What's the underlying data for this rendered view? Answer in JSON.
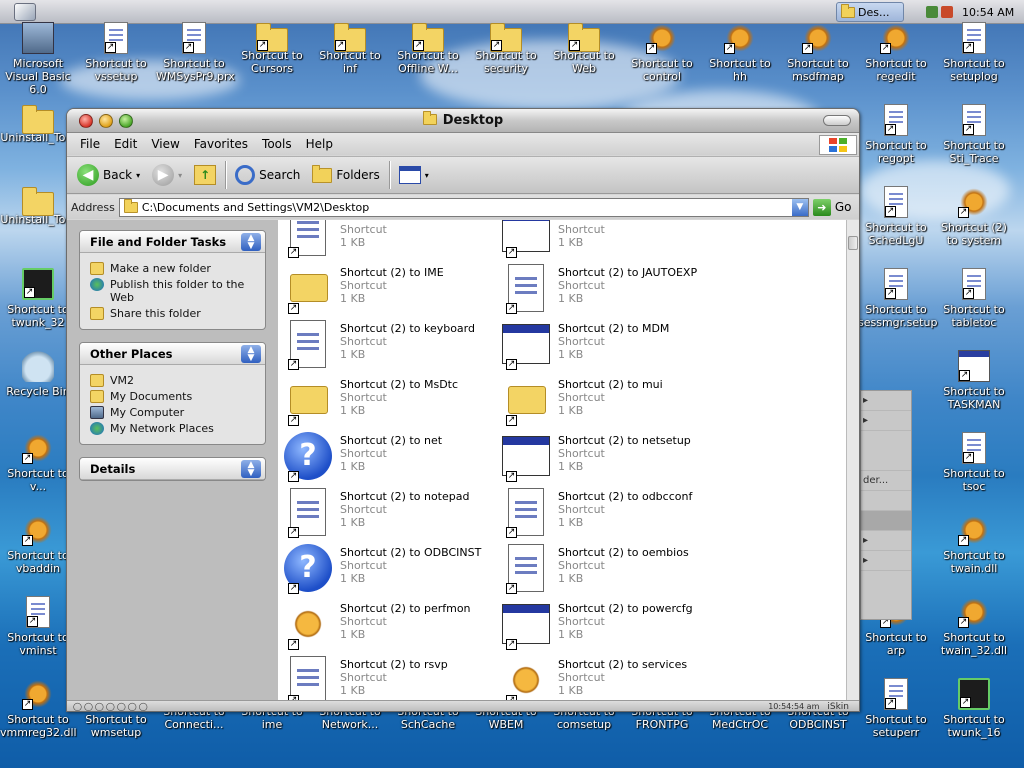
{
  "taskbar": {
    "task_label": "Des...",
    "clock": "10:54 AM"
  },
  "desktop_icons": [
    {
      "label": "Microsoft Visual Basic 6.0",
      "icon": "computer-icon"
    },
    {
      "label": "Shortcut to vssetup",
      "icon": "doc-icon"
    },
    {
      "label": "Shortcut to WMSysPr9.prx",
      "icon": "doc-icon"
    },
    {
      "label": "Shortcut to Cursors",
      "icon": "folder-icon"
    },
    {
      "label": "Shortcut to inf",
      "icon": "folder-icon"
    },
    {
      "label": "Shortcut to Offline W...",
      "icon": "folder-icon"
    },
    {
      "label": "Shortcut to security",
      "icon": "folder-icon"
    },
    {
      "label": "Shortcut to Web",
      "icon": "folder-icon"
    },
    {
      "label": "Shortcut to control",
      "icon": "gear-icon"
    },
    {
      "label": "Shortcut to hh",
      "icon": "help-icon"
    },
    {
      "label": "Shortcut to msdfmap",
      "icon": "gear-icon"
    },
    {
      "label": "Shortcut to regedit",
      "icon": "gear-icon"
    },
    {
      "label": "Shortcut to setuplog",
      "icon": "doc-icon"
    },
    {
      "label": "Shortcut to regopt",
      "icon": "doc-icon"
    },
    {
      "label": "Shortcut to Sti_Trace",
      "icon": "doc-icon"
    },
    {
      "label": "Uninstall_To...",
      "icon": "folder-icon"
    },
    {
      "label": "Uninstall_To...",
      "icon": "folder-icon"
    },
    {
      "label": "Shortcut to SchedLgU",
      "icon": "doc-icon"
    },
    {
      "label": "Shortcut (2) to system",
      "icon": "gear-icon"
    },
    {
      "label": "Shortcut to twunk_32",
      "icon": "chip-icon"
    },
    {
      "label": "Shortcut to sessmgr.setup",
      "icon": "doc-icon"
    },
    {
      "label": "Shortcut to tabletoc",
      "icon": "doc-icon"
    },
    {
      "label": "Recycle Bin",
      "icon": "recycle-bin-icon"
    },
    {
      "label": "Shortcut to TASKMAN",
      "icon": "window-icon"
    },
    {
      "label": "Shortcut to v...",
      "icon": "gear-icon"
    },
    {
      "label": "Shortcut to tsoc",
      "icon": "doc-icon"
    },
    {
      "label": "Shortcut to vbaddin",
      "icon": "gear-icon"
    },
    {
      "label": "Shortcut to twain.dll",
      "icon": "gear-icon"
    },
    {
      "label": "Shortcut to vminst",
      "icon": "doc-icon"
    },
    {
      "label": "Shortcut to twain_32.dll",
      "icon": "gear-icon"
    },
    {
      "label": "Shortcut to arp",
      "icon": "gear-icon"
    },
    {
      "label": "Shortcut to vmmreg32.dll",
      "icon": "gear-icon"
    },
    {
      "label": "Shortcut to wmsetup",
      "icon": "doc-icon"
    },
    {
      "label": "Shortcut to Connecti...",
      "icon": "folder-icon"
    },
    {
      "label": "Shortcut to ime",
      "icon": "folder-icon"
    },
    {
      "label": "Shortcut to Network...",
      "icon": "folder-icon"
    },
    {
      "label": "Shortcut to SchCache",
      "icon": "folder-icon"
    },
    {
      "label": "Shortcut to WBEM",
      "icon": "folder-icon"
    },
    {
      "label": "Shortcut to comsetup",
      "icon": "folder-icon"
    },
    {
      "label": "Shortcut to FRONTPG",
      "icon": "folder-icon"
    },
    {
      "label": "Shortcut to MedCtrOC",
      "icon": "folder-icon"
    },
    {
      "label": "Shortcut to ODBCINST",
      "icon": "folder-icon"
    },
    {
      "label": "Shortcut to setuperr",
      "icon": "doc-icon"
    },
    {
      "label": "Shortcut to twunk_16",
      "icon": "chip-icon"
    }
  ],
  "background_menu": [
    "der..."
  ],
  "window": {
    "title": "Desktop",
    "menu": [
      "File",
      "Edit",
      "View",
      "Favorites",
      "Tools",
      "Help"
    ],
    "toolbar": {
      "back": "Back",
      "search": "Search",
      "folders": "Folders"
    },
    "address_label": "Address",
    "address_value": "C:\\Documents and Settings\\VM2\\Desktop",
    "go_label": "Go",
    "tasks": {
      "file_folder_title": "File and Folder Tasks",
      "file_folder_links": [
        "Make a new folder",
        "Publish this folder to the Web",
        "Share this folder"
      ],
      "other_places_title": "Other Places",
      "other_places_links": [
        "VM2",
        "My Documents",
        "My Computer",
        "My Network Places"
      ],
      "details_title": "Details"
    },
    "files": [
      {
        "name": "",
        "type": "Shortcut",
        "size": "1 KB",
        "icon": "help-doc-icon"
      },
      {
        "name": "",
        "type": "Shortcut",
        "size": "1 KB",
        "icon": "window-icon"
      },
      {
        "name": "Shortcut (2) to IME",
        "type": "Shortcut",
        "size": "1 KB",
        "icon": "folder-icon"
      },
      {
        "name": "Shortcut (2) to JAUTOEXP",
        "type": "Shortcut",
        "size": "1 KB",
        "icon": "gear-doc-icon"
      },
      {
        "name": "Shortcut (2) to keyboard",
        "type": "Shortcut",
        "size": "1 KB",
        "icon": "doc-icon"
      },
      {
        "name": "Shortcut (2) to MDM",
        "type": "Shortcut",
        "size": "1 KB",
        "icon": "window-icon"
      },
      {
        "name": "Shortcut (2) to MsDtc",
        "type": "Shortcut",
        "size": "1 KB",
        "icon": "folder-icon"
      },
      {
        "name": "Shortcut (2) to mui",
        "type": "Shortcut",
        "size": "1 KB",
        "icon": "folder-icon"
      },
      {
        "name": "Shortcut (2) to net",
        "type": "Shortcut",
        "size": "1 KB",
        "icon": "help-icon"
      },
      {
        "name": "Shortcut (2) to netsetup",
        "type": "Shortcut",
        "size": "1 KB",
        "icon": "setup-icon"
      },
      {
        "name": "Shortcut (2) to notepad",
        "type": "Shortcut",
        "size": "1 KB",
        "icon": "notepad-icon"
      },
      {
        "name": "Shortcut (2) to odbcconf",
        "type": "Shortcut",
        "size": "1 KB",
        "icon": "doc-icon"
      },
      {
        "name": "Shortcut (2) to ODBCINST",
        "type": "Shortcut",
        "size": "1 KB",
        "icon": "help-icon"
      },
      {
        "name": "Shortcut (2) to oembios",
        "type": "Shortcut",
        "size": "1 KB",
        "icon": "doc-icon"
      },
      {
        "name": "Shortcut (2) to perfmon",
        "type": "Shortcut",
        "size": "1 KB",
        "icon": "perfmon-icon"
      },
      {
        "name": "Shortcut (2) to powercfg",
        "type": "Shortcut",
        "size": "1 KB",
        "icon": "window-icon"
      },
      {
        "name": "Shortcut (2) to rsvp",
        "type": "Shortcut",
        "size": "1 KB",
        "icon": "gear-doc-icon"
      },
      {
        "name": "Shortcut (2) to services",
        "type": "Shortcut",
        "size": "1 KB",
        "icon": "gear-icon"
      }
    ],
    "status": {
      "clock": "10:54:54 am",
      "skin": "iSkin"
    }
  }
}
